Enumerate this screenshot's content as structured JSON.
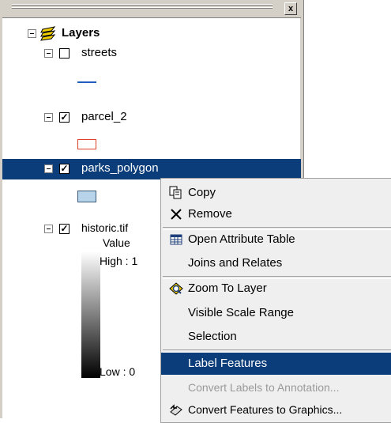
{
  "panel": {
    "close_label": "x"
  },
  "toc": {
    "root_label": "Layers",
    "layers": [
      {
        "name": "streets",
        "checked": false
      },
      {
        "name": "parcel_2",
        "checked": true
      },
      {
        "name": "parks_polygon",
        "checked": true,
        "selected": true
      },
      {
        "name": "historic.tif",
        "checked": true
      }
    ],
    "raster_legend": {
      "value_label": "Value",
      "high_label": "High : 1",
      "low_label": "Low : 0"
    }
  },
  "context_menu": {
    "items": [
      {
        "label": "Copy",
        "icon": "copy-icon"
      },
      {
        "label": "Remove",
        "icon": "remove-icon"
      },
      {
        "label": "Open Attribute Table",
        "icon": "table-icon"
      },
      {
        "label": "Joins and Relates",
        "submenu": true
      },
      {
        "label": "Zoom To Layer",
        "icon": "zoom-to-layer-icon"
      },
      {
        "label": "Visible Scale Range",
        "submenu": true
      },
      {
        "label": "Selection",
        "submenu": true
      },
      {
        "label": "Label Features",
        "highlighted": true
      },
      {
        "label": "Convert Labels to Annotation...",
        "disabled": true
      },
      {
        "label": "Convert Features to Graphics...",
        "icon": "convert-graphics-icon"
      }
    ]
  },
  "colors": {
    "selection": "#0a3d7a",
    "streets_line": "#1f5fbf",
    "parcel_outline": "#e0402a",
    "parks_fill": "#b8d4ea"
  }
}
